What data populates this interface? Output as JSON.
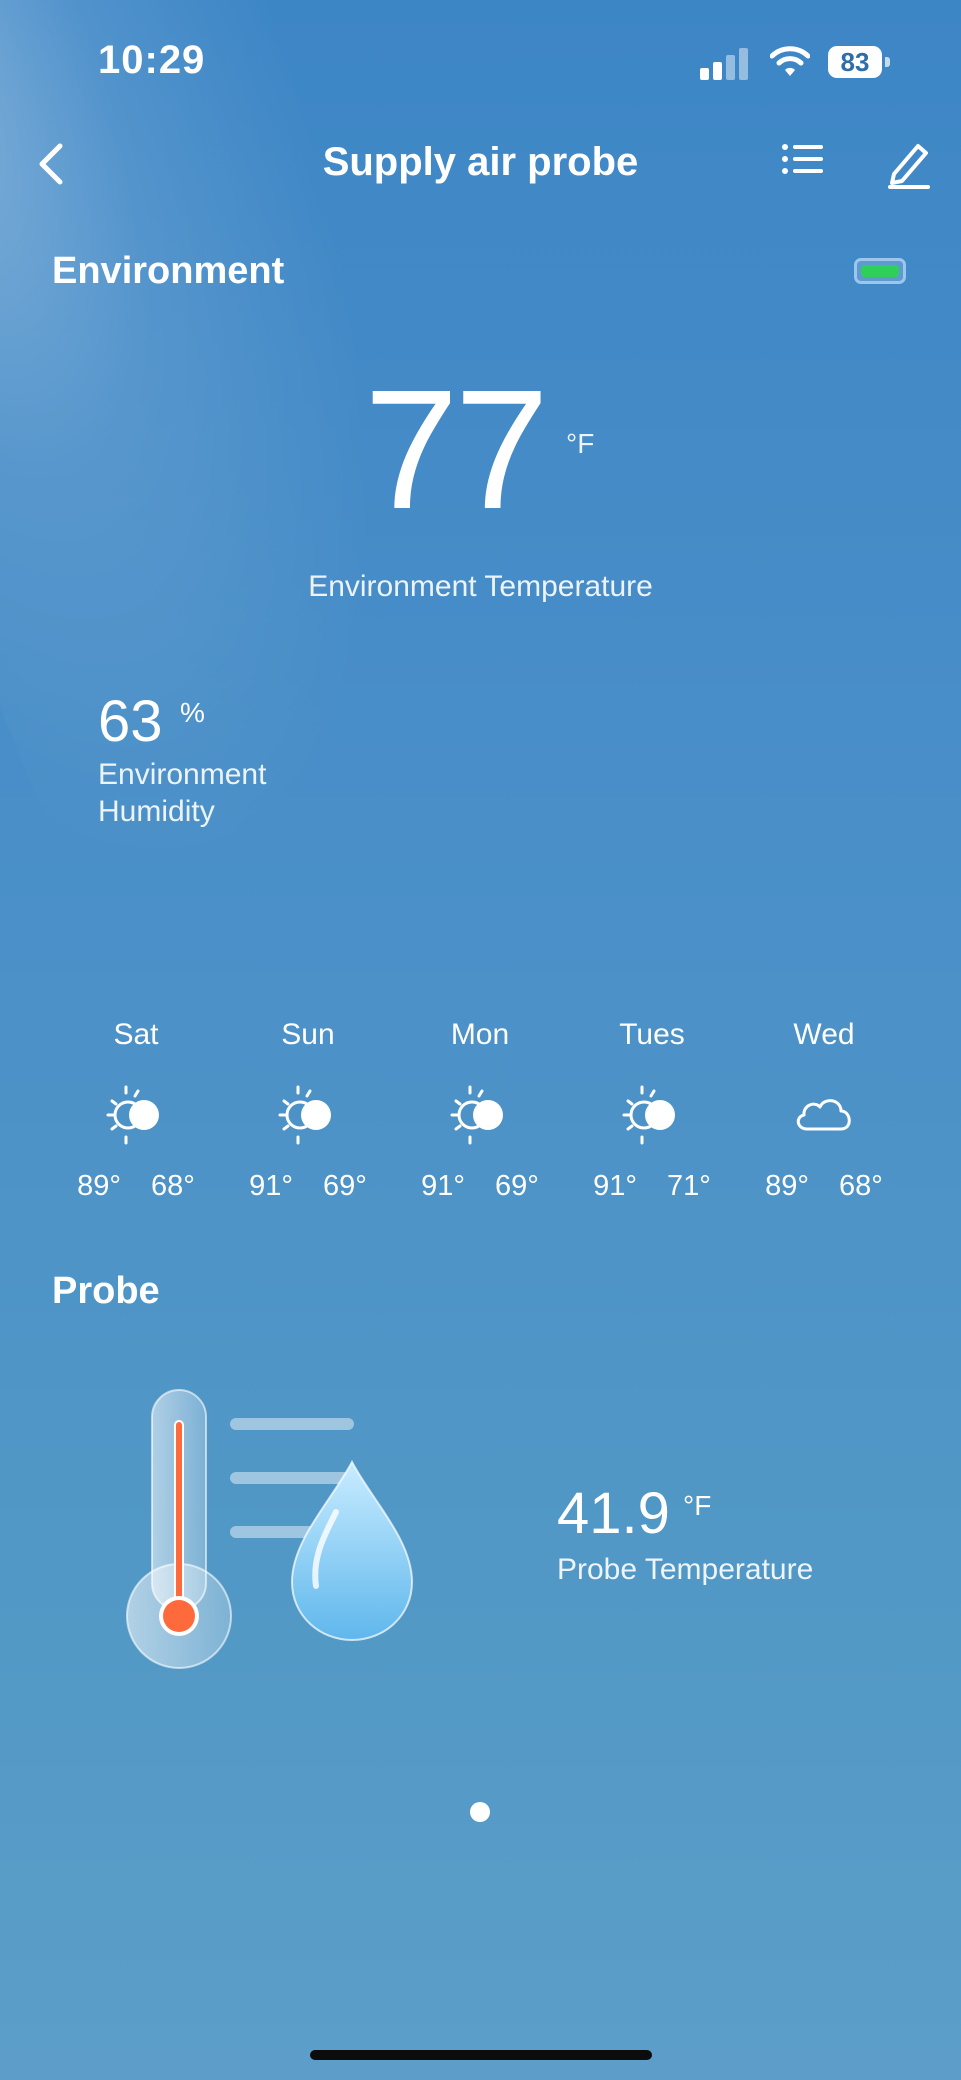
{
  "status_bar": {
    "time": "10:29",
    "battery_level": "83",
    "signal_icon": "cellular-signal-icon",
    "wifi_icon": "wifi-icon"
  },
  "nav": {
    "title": "Supply air probe",
    "back_icon": "chevron-left-icon",
    "list_icon": "list-icon",
    "edit_icon": "pencil-icon"
  },
  "environment": {
    "section_title": "Environment",
    "device_battery_color": "#2fd05a",
    "temperature": {
      "value": "77",
      "unit": "°F",
      "label": "Environment Temperature"
    },
    "humidity": {
      "value": "63",
      "unit": "%",
      "label": "Environment Humidity"
    }
  },
  "forecast": [
    {
      "day": "Sat",
      "icon": "partly-sunny-icon",
      "high": "89°",
      "low": "68°"
    },
    {
      "day": "Sun",
      "icon": "partly-sunny-icon",
      "high": "91°",
      "low": "69°"
    },
    {
      "day": "Mon",
      "icon": "partly-sunny-icon",
      "high": "91°",
      "low": "69°"
    },
    {
      "day": "Tues",
      "icon": "partly-sunny-icon",
      "high": "91°",
      "low": "71°"
    },
    {
      "day": "Wed",
      "icon": "cloud-icon",
      "high": "89°",
      "low": "68°"
    }
  ],
  "probe": {
    "section_title": "Probe",
    "value": "41.9",
    "unit": "°F",
    "label": "Probe Temperature",
    "graphic_icon": "thermometer-droplet-icon"
  },
  "pagination": {
    "pages": 1,
    "current": 1
  },
  "colors": {
    "background_top": "#3d86c6",
    "background_bottom": "#5c9ec9",
    "thermometer_red": "#ff6a3d"
  }
}
